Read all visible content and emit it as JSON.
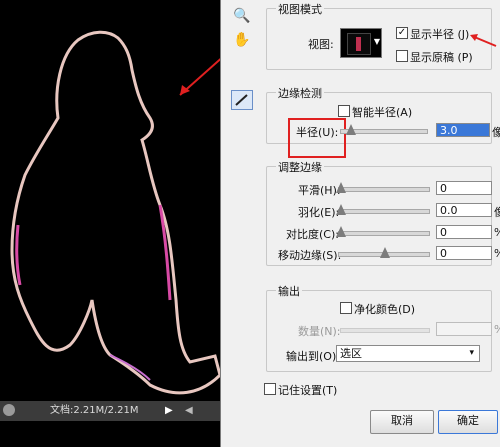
{
  "canvas": {
    "status_text": "文档:2.21M/2.21M"
  },
  "tools": {
    "zoom_icon": "magnifier-icon",
    "hand_icon": "hand-icon",
    "refine_radius_icon": "refine-brush-icon"
  },
  "view_mode": {
    "title": "视图模式",
    "view_label": "视图:",
    "show_radius_label": "显示半径 (J)",
    "show_radius_checked": true,
    "show_original_label": "显示原稿 (P)",
    "show_original_checked": false
  },
  "edge_detection": {
    "title": "边缘检测",
    "smart_radius_label": "智能半径(A)",
    "smart_radius_checked": false,
    "radius_label": "半径(U):",
    "radius_value": "3.0",
    "radius_unit": "像"
  },
  "adjust_edge": {
    "title": "调整边缘",
    "rows": [
      {
        "label": "平滑(H):",
        "value": "0",
        "unit": ""
      },
      {
        "label": "羽化(E):",
        "value": "0.0",
        "unit": "像"
      },
      {
        "label": "对比度(C):",
        "value": "0",
        "unit": "%"
      },
      {
        "label": "移动边缘(S):",
        "value": "0",
        "unit": "%"
      }
    ]
  },
  "output": {
    "title": "输出",
    "decontaminate_label": "净化颜色(D)",
    "decontaminate_checked": false,
    "amount_label": "数量(N):",
    "amount_unit": "%",
    "output_to_label": "输出到(O):",
    "output_to_value": "选区"
  },
  "remember_label": "记住设置(T)",
  "remember_checked": false,
  "buttons": {
    "cancel": "取消",
    "ok": "确定"
  },
  "colors": {
    "dialog_bg": "#f0f0f0",
    "annotation_red": "#e02020",
    "field_highlight": "#3b78d8"
  }
}
